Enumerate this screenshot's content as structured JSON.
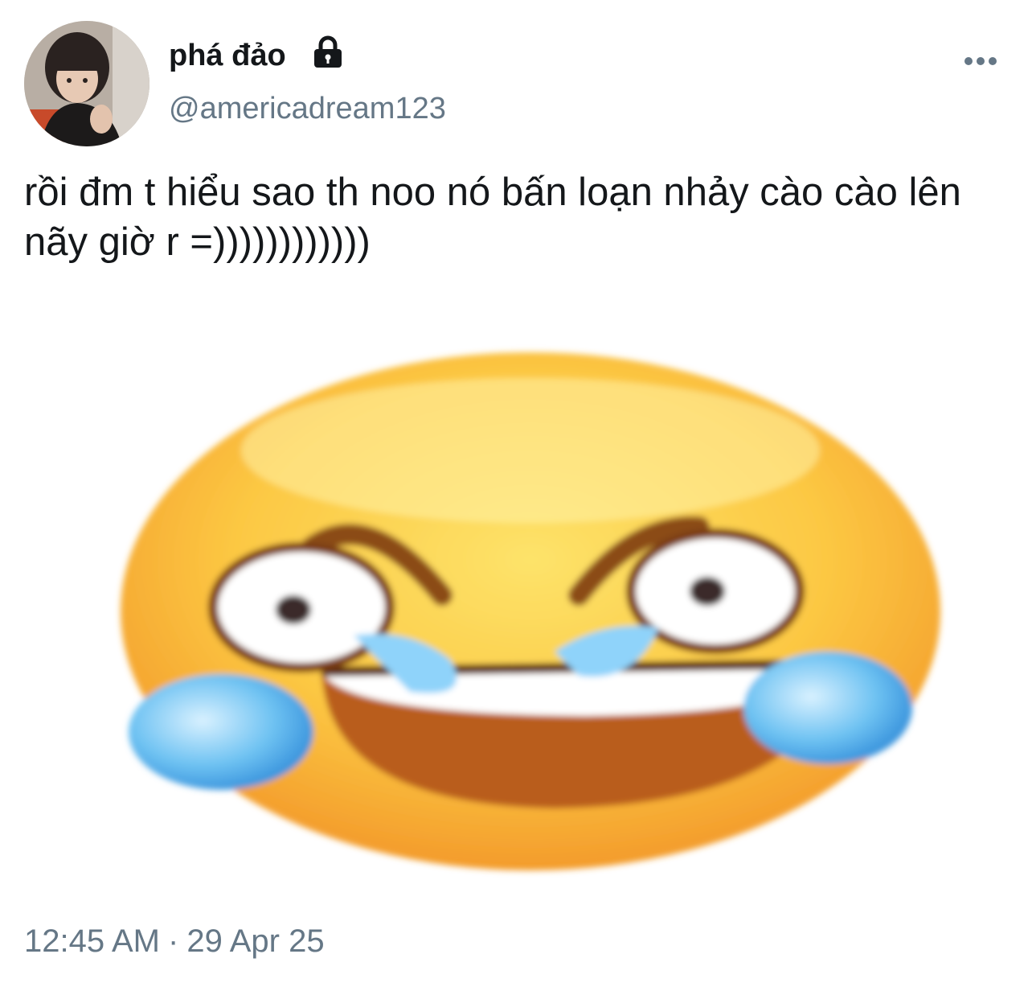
{
  "tweet": {
    "author": {
      "display_name": "phá đảo",
      "handle": "@americadream123",
      "avatar_icon": "user-avatar-photo",
      "protected_icon": "lock-icon"
    },
    "more_icon": "more-horizontal-icon",
    "text": "rồi đm t hiểu sao th noo nó bấn loạn nhảy cào cào lên nãy giờ r =))))))))))))",
    "media": {
      "icon": "laughing-crying-emoji-image"
    },
    "time": "12:45 AM",
    "separator": "·",
    "date": "29 Apr 25"
  },
  "colors": {
    "text_primary": "#14171a",
    "text_secondary": "#657786",
    "background": "#ffffff"
  }
}
